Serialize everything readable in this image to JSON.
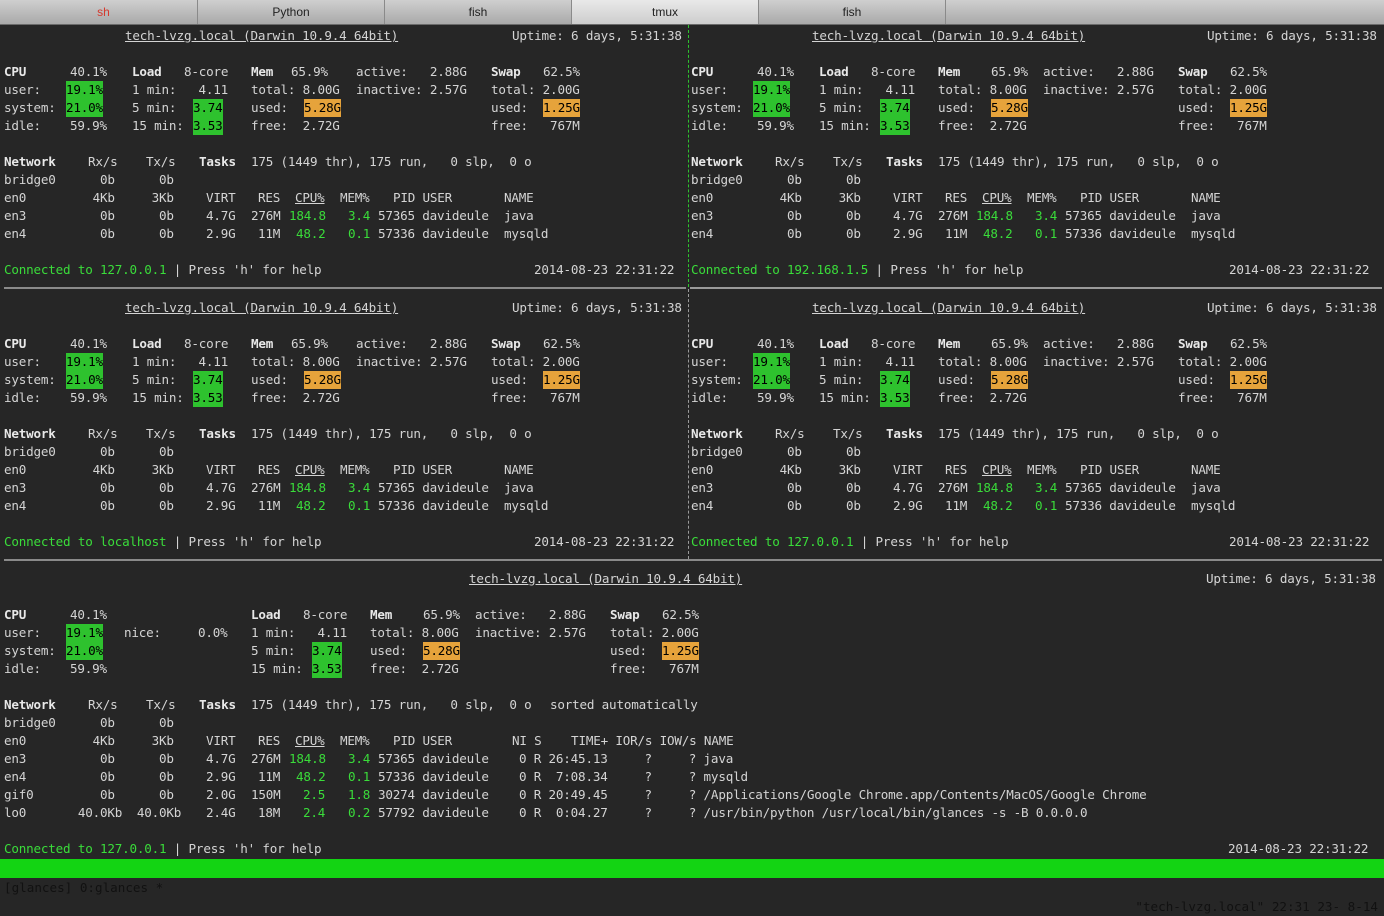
{
  "tabs": [
    {
      "label": "sh",
      "active": false
    },
    {
      "label": "Python",
      "active": false
    },
    {
      "label": "fish",
      "active": false
    },
    {
      "label": "tmux",
      "active": true
    },
    {
      "label": "fish",
      "active": false
    }
  ],
  "pane": {
    "host": "tech-lvzg.local (Darwin 10.9.4 64bit)",
    "uptime": "Uptime: 6 days, 5:31:38",
    "cpu_row": {
      "cpu_label": "CPU",
      "cpu_val": "40.1%",
      "load_label": "Load",
      "cores": "8-core",
      "mem_label": "Mem",
      "mem_val": "65.9%",
      "active": "active:   2.88G",
      "swap_label": "Swap",
      "swap_val": "62.5%"
    },
    "user_row": {
      "label": "user:",
      "val": "19.1%",
      "load": "1 min:   4.11",
      "mem": "total: 8.00G",
      "inactive": "inactive: 2.57G",
      "swap": "total: 2.00G"
    },
    "system_row": {
      "label": "system:",
      "val": "21.0%",
      "load_label": "5 min:",
      "load_val": "3.74",
      "mem_label": "used:",
      "mem_val": "5.28G",
      "swap_label": "used:",
      "swap_val": "1.25G"
    },
    "idle_row": {
      "label": "idle:",
      "val": "59.9%",
      "load_label": "15 min:",
      "load_val": "3.53",
      "mem": "free:  2.72G",
      "swap": "free:   767M"
    },
    "net_header": {
      "network": "Network",
      "rx": "Rx/s",
      "tx": "Tx/s",
      "tasks": "Tasks",
      "tasks_text": "175 (1449 thr), 175 run,   0 slp,  0 o"
    },
    "bridge0": "bridge0      0b      0b",
    "en0": "en0         4Kb     3Kb",
    "proc_header": {
      "virt": "VIRT",
      "res": "RES",
      "cpu": "CPU%",
      "mem": "MEM%",
      "pid": "PID USER",
      "name": "NAME"
    },
    "en3": "en3          0b      0b",
    "en4": "en4          0b      0b",
    "proc1": {
      "virt": "4.7G",
      "res": "276M",
      "cpu": "184.8",
      "mem": "3.4",
      "pid": "57365 davideule",
      "name": "java"
    },
    "proc2": {
      "virt": "2.9G",
      "res": "11M",
      "cpu": "48.2",
      "mem": "0.1",
      "pid": "57336 davideule",
      "name": "mysqld"
    },
    "press_help": " | Press 'h' for help",
    "date": "2014-08-23 22:31:22"
  },
  "connections": {
    "top_left": "Connected to 127.0.0.1",
    "top_right": "Connected to 192.168.1.5",
    "mid_left": "Connected to localhost",
    "mid_right": "Connected to 127.0.0.1",
    "bottom": "Connected to 127.0.0.1"
  },
  "bottom_pane": {
    "nice_label": "nice:",
    "nice_val": "0.0%",
    "sorted": "sorted automatically",
    "proc_header_tail": "NI S    TIME+ IOR/s IOW/s NAME",
    "gif0": "gif0         0b      0b",
    "lo0": "lo0       40.0Kb  40.0Kb",
    "procs": [
      {
        "virt": "4.7G",
        "res": "276M",
        "cpu": "184.8",
        "mem": "3.4",
        "pid": "57365 davideule",
        "tail": "0 R 26:45.13     ?     ? java"
      },
      {
        "virt": "2.9G",
        "res": "11M",
        "cpu": "48.2",
        "mem": "0.1",
        "pid": "57336 davideule",
        "tail": "0 R  7:08.34     ?     ? mysqld"
      },
      {
        "virt": "2.0G",
        "res": "150M",
        "cpu": "2.5",
        "mem": "1.8",
        "pid": "30274 davideule",
        "tail": "0 R 20:49.45     ?     ? /Applications/Google Chrome.app/Contents/MacOS/Google Chrome"
      },
      {
        "virt": "2.4G",
        "res": "18M",
        "cpu": "2.4",
        "mem": "0.2",
        "pid": "57792 davideule",
        "tail": "0 R  0:04.27     ?     ? /usr/bin/python /usr/local/bin/glances -s -B 0.0.0.0"
      }
    ]
  },
  "statusbar": {
    "left": "[glances] 0:glances *",
    "right": "\"tech-lvzg.local\" 22:31 23- 8-14"
  },
  "colors": {
    "green": "#2ec22e",
    "orange": "#e6a33b",
    "status_green": "#13d413",
    "background": "#262626"
  }
}
